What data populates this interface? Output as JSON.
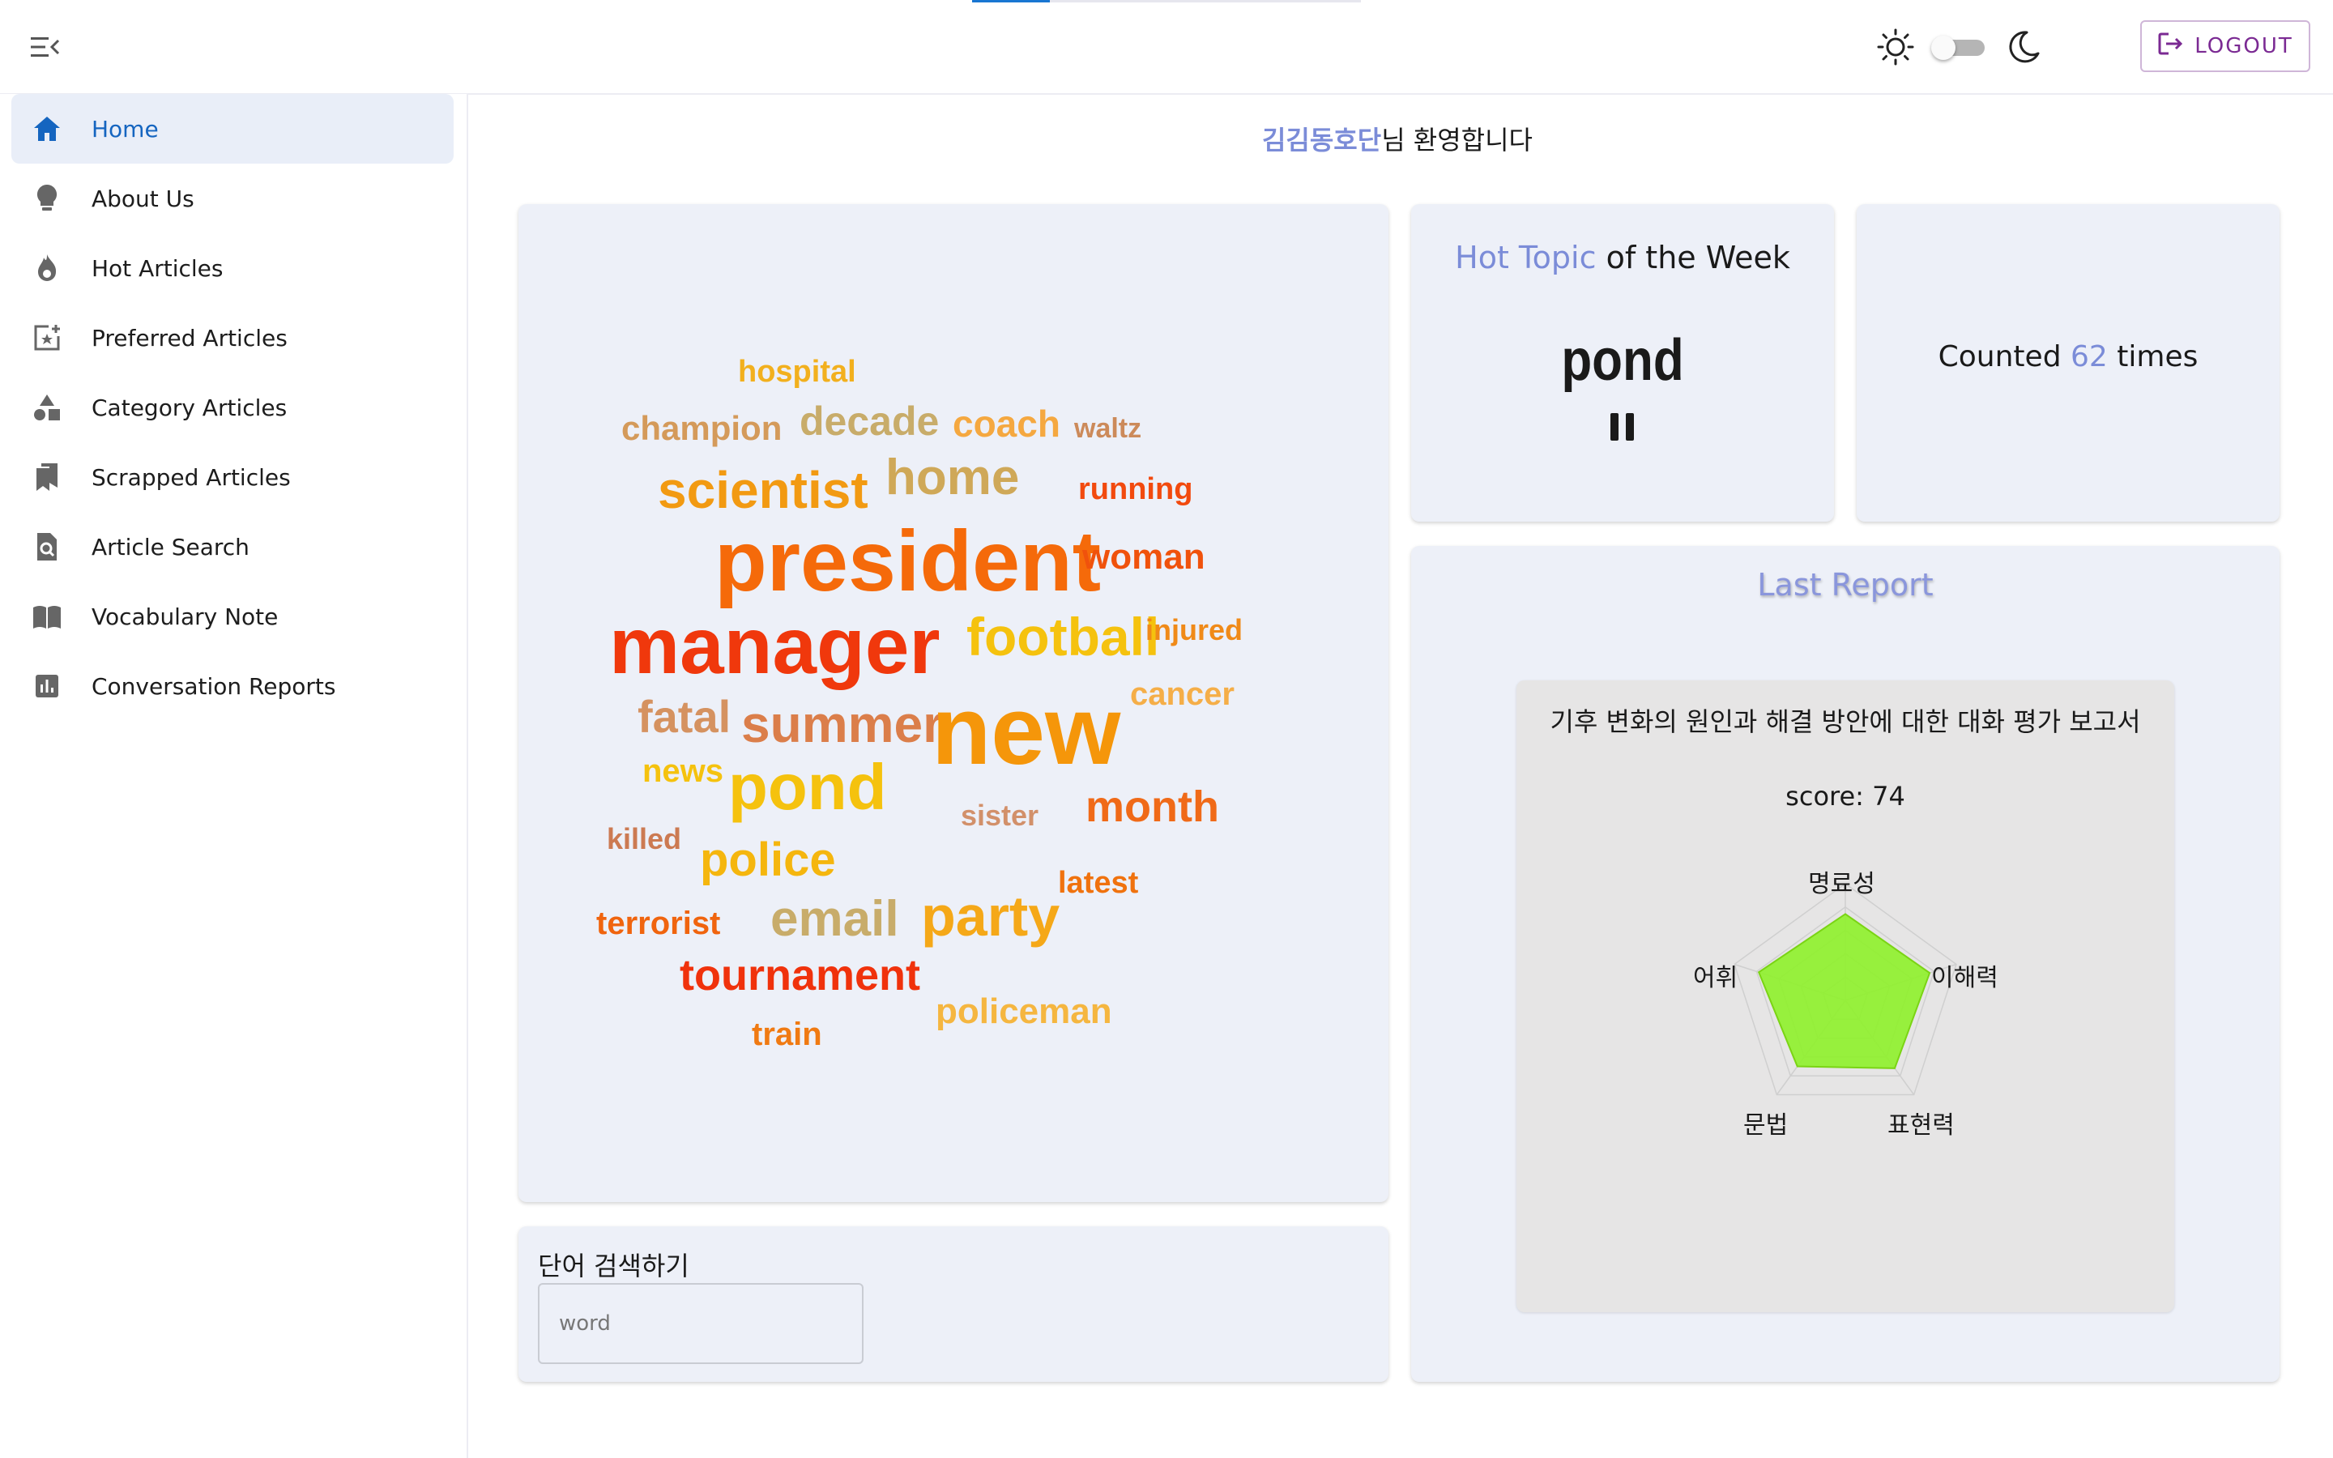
{
  "header": {
    "logout_label": "LOGOUT"
  },
  "sidebar": {
    "items": [
      {
        "label": "Home",
        "icon": "home-icon",
        "active": true
      },
      {
        "label": "About Us",
        "icon": "lightbulb-icon"
      },
      {
        "label": "Hot Articles",
        "icon": "fire-icon"
      },
      {
        "label": "Preferred Articles",
        "icon": "add-star-icon"
      },
      {
        "label": "Category Articles",
        "icon": "category-shapes-icon"
      },
      {
        "label": "Scrapped Articles",
        "icon": "bookmarks-icon"
      },
      {
        "label": "Article Search",
        "icon": "document-search-icon"
      },
      {
        "label": "Vocabulary Note",
        "icon": "open-book-icon"
      },
      {
        "label": "Conversation Reports",
        "icon": "bar-chart-icon"
      }
    ]
  },
  "welcome": {
    "username": "김김동호단",
    "suffix": "님 환영합니다"
  },
  "word_cloud": {
    "words": [
      {
        "text": "hospital",
        "color": "#f2b01e"
      },
      {
        "text": "champion",
        "color": "#d49a5a"
      },
      {
        "text": "decade",
        "color": "#c8ac6a"
      },
      {
        "text": "coach",
        "color": "#f5a840"
      },
      {
        "text": "waltz",
        "color": "#cc8a5a"
      },
      {
        "text": "scientist",
        "color": "#f29a12"
      },
      {
        "text": "home",
        "color": "#cfa858"
      },
      {
        "text": "running",
        "color": "#f24a0e"
      },
      {
        "text": "president",
        "color": "#f56a0a"
      },
      {
        "text": "woman",
        "color": "#f0520c"
      },
      {
        "text": "manager",
        "color": "#f0380c"
      },
      {
        "text": "football",
        "color": "#f5c20e"
      },
      {
        "text": "injured",
        "color": "#f08a18"
      },
      {
        "text": "cancer",
        "color": "#f5ae48"
      },
      {
        "text": "fatal",
        "color": "#d59260"
      },
      {
        "text": "summer",
        "color": "#db7e4a"
      },
      {
        "text": "new",
        "color": "#f5960a"
      },
      {
        "text": "news",
        "color": "#f5c20e"
      },
      {
        "text": "pond",
        "color": "#f5c20e"
      },
      {
        "text": "sister",
        "color": "#d2906a"
      },
      {
        "text": "month",
        "color": "#f06a18"
      },
      {
        "text": "killed",
        "color": "#cc7a52"
      },
      {
        "text": "police",
        "color": "#f5b60e"
      },
      {
        "text": "latest",
        "color": "#f0720e"
      },
      {
        "text": "terrorist",
        "color": "#f0640e"
      },
      {
        "text": "email",
        "color": "#c8ac6a"
      },
      {
        "text": "party",
        "color": "#f5a818"
      },
      {
        "text": "tournament",
        "color": "#f0320c"
      },
      {
        "text": "policeman",
        "color": "#f5b640"
      },
      {
        "text": "train",
        "color": "#f07a12"
      }
    ]
  },
  "search": {
    "title": "단어 검색하기",
    "placeholder": "word"
  },
  "hot_topic": {
    "title_accent": "Hot Topic",
    "title_rest": " of the Week",
    "word": "pond"
  },
  "count": {
    "prefix": "Counted ",
    "value": "62",
    "suffix": " times"
  },
  "report": {
    "heading": "Last Report",
    "title": "기후 변화의 원인과 해결 방안에 대한 대화 평가 보고서",
    "score_text": "score: 74",
    "radar": {
      "axes": [
        "명료성",
        "이해력",
        "표현력",
        "문법",
        "어휘"
      ],
      "values": [
        0.74,
        0.76,
        0.72,
        0.7,
        0.78
      ],
      "fill_color": "#8ef12a"
    }
  },
  "colors": {
    "accent": "#7b8cd8",
    "active_nav": "#1565c0",
    "logout": "#7b2a93",
    "card_bg": "#edf0f8"
  }
}
